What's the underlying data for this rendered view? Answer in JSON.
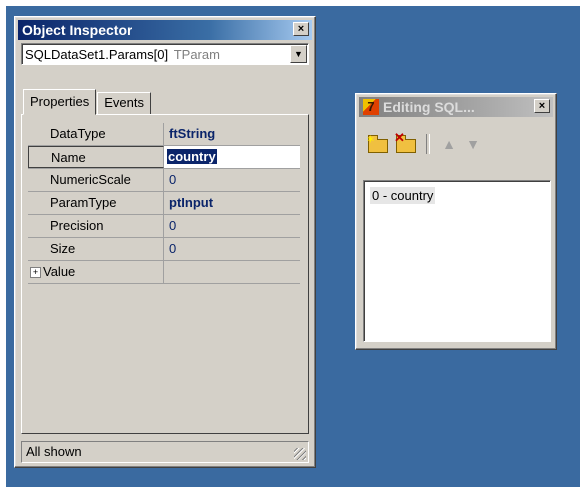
{
  "object_inspector": {
    "title": "Object Inspector",
    "close_glyph": "×",
    "selector": {
      "component": "SQLDataSet1.Params[0]",
      "type": "TParam"
    },
    "tabs": [
      {
        "label": "Properties",
        "active": true
      },
      {
        "label": "Events",
        "active": false
      }
    ],
    "properties": [
      {
        "name": "DataType",
        "value": "ftString"
      },
      {
        "name": "Name",
        "value": "country"
      },
      {
        "name": "NumericScale",
        "value": "0"
      },
      {
        "name": "ParamType",
        "value": "ptInput"
      },
      {
        "name": "Precision",
        "value": "0"
      },
      {
        "name": "Size",
        "value": "0"
      },
      {
        "name": "Value",
        "value": ""
      }
    ],
    "expander_glyph": "+",
    "status": "All shown"
  },
  "sql_editor": {
    "title": "Editing SQL...",
    "close_glyph": "×",
    "app_icon_glyph": "7",
    "toolbar": {
      "add_icon": "add-folder-icon",
      "delete_icon": "delete-folder-icon",
      "up_glyph": "▲",
      "down_glyph": "▼"
    },
    "items": [
      "0 - country"
    ]
  },
  "colors": {
    "desktop": "#3a6aa0",
    "active_title": "#0a246a",
    "value_text": "#0a246a"
  }
}
